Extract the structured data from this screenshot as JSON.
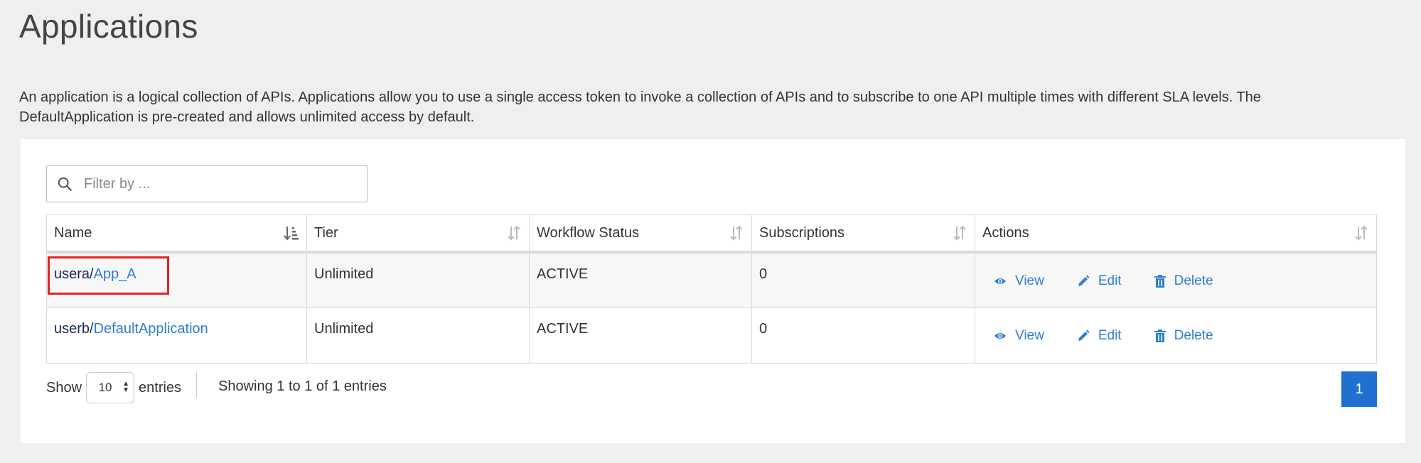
{
  "page": {
    "title": "Applications",
    "description": "An application is a logical collection of APIs. Applications allow you to use a single access token to invoke a collection of APIs and to subscribe to one API multiple times with different SLA levels. The DefaultApplication is pre-created and allows unlimited access by default."
  },
  "search": {
    "placeholder": "Filter by ..."
  },
  "table": {
    "columns": [
      "Name",
      "Tier",
      "Workflow Status",
      "Subscriptions",
      "Actions"
    ],
    "rows": [
      {
        "owner": "usera",
        "sep": "/",
        "app": "App_A",
        "tier": "Unlimited",
        "status": "ACTIVE",
        "subscriptions": "0"
      },
      {
        "owner": "userb",
        "sep": "/",
        "app": "DefaultApplication",
        "tier": "Unlimited",
        "status": "ACTIVE",
        "subscriptions": "0"
      }
    ],
    "actions": {
      "view": "View",
      "edit": "Edit",
      "delete": "Delete"
    }
  },
  "footer": {
    "show_label": "Show",
    "page_length": "10",
    "entries_label": "entries",
    "info": "Showing 1 to 1 of 1 entries",
    "current_page": "1"
  },
  "colors": {
    "link": "#2f7dd1",
    "highlight": "#e8231e",
    "pagination": "#2070d2"
  }
}
